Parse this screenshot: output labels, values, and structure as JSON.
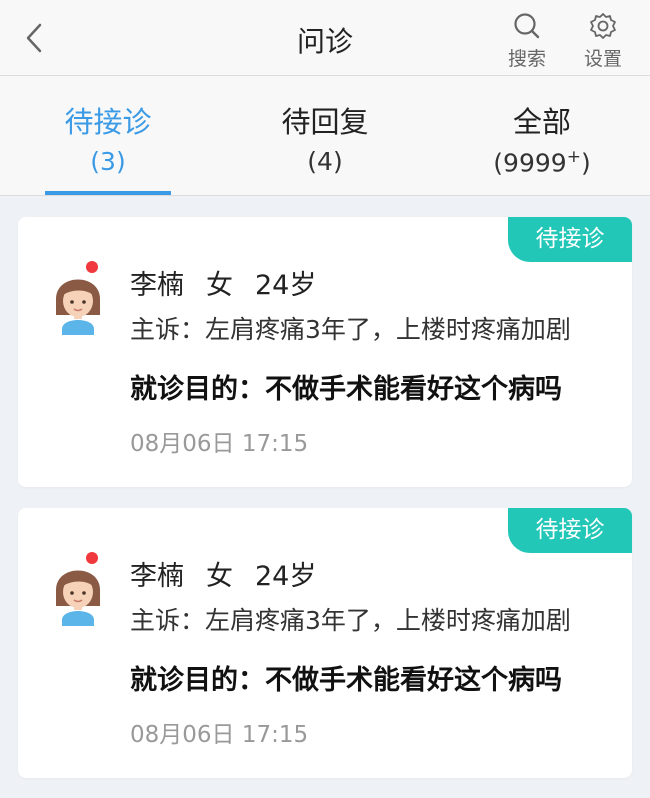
{
  "header": {
    "title": "问诊",
    "search_label": "搜索",
    "settings_label": "设置"
  },
  "tabs": [
    {
      "label": "待接诊",
      "count": "(3)",
      "active": true
    },
    {
      "label": "待回复",
      "count": "(4)",
      "active": false
    },
    {
      "label": "全部",
      "count": "(9999",
      "count_sup": "+",
      "count_close": ")",
      "active": false
    }
  ],
  "cards": [
    {
      "badge": "待接诊",
      "name": "李楠",
      "gender": "女",
      "age": "24岁",
      "complaint": "主诉：左肩疼痛3年了，上楼时疼痛加剧",
      "purpose": "就诊目的：不做手术能看好这个病吗",
      "time": "08月06日 17:15"
    },
    {
      "badge": "待接诊",
      "name": "李楠",
      "gender": "女",
      "age": "24岁",
      "complaint": "主诉：左肩疼痛3年了，上楼时疼痛加剧",
      "purpose": "就诊目的：不做手术能看好这个病吗",
      "time": "08月06日 17:15"
    }
  ],
  "colors": {
    "accent": "#3a9ae6",
    "badge": "#22c7b7",
    "unread_dot": "#f0393c",
    "background": "#eef1f5"
  },
  "icons": {
    "back": "chevron-left-icon",
    "search": "search-icon",
    "settings": "gear-icon",
    "avatar": "female-avatar-icon"
  }
}
